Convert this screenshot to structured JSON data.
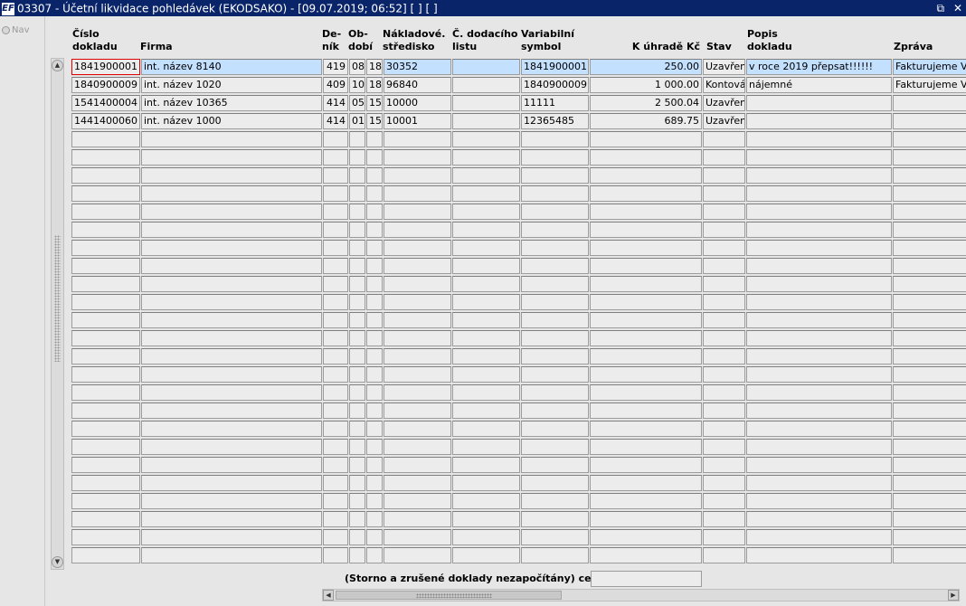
{
  "window": {
    "logo": "EF",
    "title": "03307 - Účetní likvidace pohledávek (EKODSAKO) - [09.07.2019; 06:52]  [ ]  [ ]",
    "restore_glyph": "⧉",
    "close_glyph": "✕"
  },
  "nav": {
    "label": "Nav"
  },
  "columns": {
    "cislo": [
      "Číslo",
      "dokladu"
    ],
    "firma": [
      "",
      "Firma"
    ],
    "denik": [
      "De-",
      "ník"
    ],
    "obdobi": [
      "Ob-",
      "dobí"
    ],
    "nakladove": [
      "Nákladové.",
      "středisko"
    ],
    "dodaci": [
      "Č. dodacího",
      "listu"
    ],
    "variabilni": [
      "Variabilní",
      "symbol"
    ],
    "kuhrade": [
      "",
      "K úhradě Kč"
    ],
    "stav": [
      "",
      "Stav"
    ],
    "popis": [
      "Popis",
      "dokladu"
    ],
    "zprava": [
      "",
      "Zpráva"
    ]
  },
  "rows": [
    [
      "1841900001",
      "int. název 8140",
      "419",
      "08",
      "18",
      "30352",
      "",
      "1841900001",
      "250.00",
      "Uzavřen",
      "v roce 2019 přepsat!!!!!!",
      "Fakturujeme Vá"
    ],
    [
      "1840900009",
      "int. název 1020",
      "409",
      "10",
      "18",
      "96840",
      "",
      "1840900009",
      "1 000.00",
      "Kontován",
      "nájemné",
      "Fakturujeme Vá"
    ],
    [
      "1541400004",
      "int. název 10365",
      "414",
      "05",
      "15",
      "10000",
      "",
      "11111",
      "2 500.04",
      "Uzavřen",
      "",
      ""
    ],
    [
      "1441400060",
      "int. název 1000",
      "414",
      "01",
      "15",
      "10001",
      "",
      "12365485",
      "689.75",
      "Uzavřen",
      "",
      ""
    ]
  ],
  "footer": {
    "label": "(Storno a zrušené doklady nezapočítány) celkem",
    "total": ""
  }
}
